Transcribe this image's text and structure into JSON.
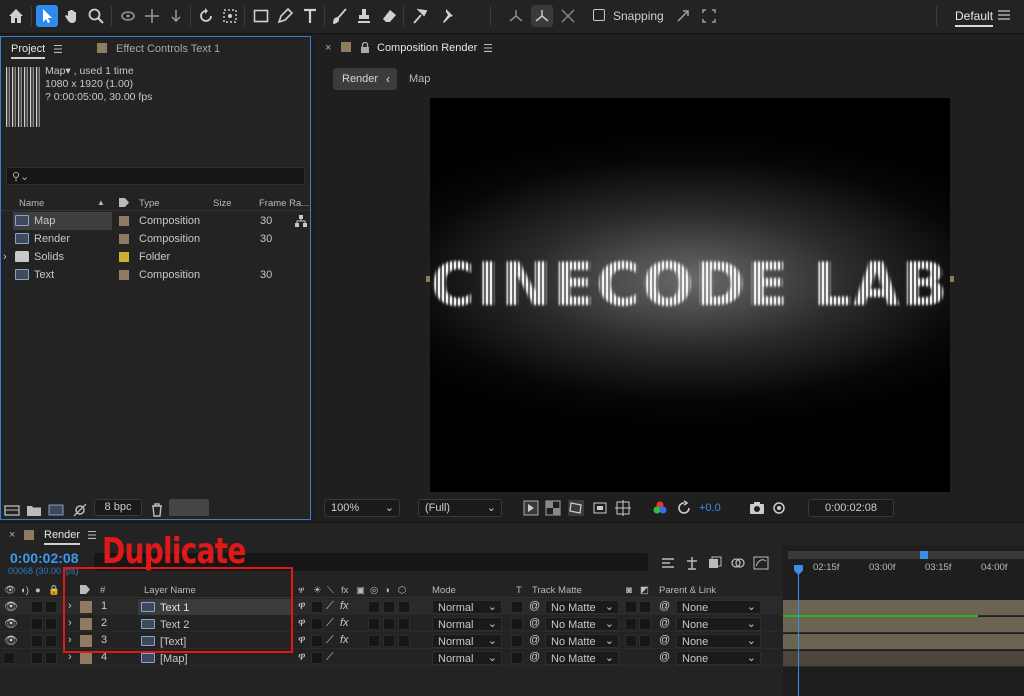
{
  "toolbar": {
    "snapping_label": "Snapping",
    "workspace": "Default"
  },
  "project_panel": {
    "tab_project": "Project",
    "tab_effect_controls": "Effect Controls Text 1",
    "selected_info": {
      "line1": "Map▾ , used 1 time",
      "line2": "1080 x 1920 (1.00)",
      "line3": "? 0:00:05:00, 30.00 fps"
    },
    "search_placeholder": "",
    "columns": [
      "Name",
      "Type",
      "Size",
      "Frame Ra..."
    ],
    "items": [
      {
        "name": "Map",
        "type": "Composition",
        "fps": "30",
        "color": "#8e7b62"
      },
      {
        "name": "Render",
        "type": "Composition",
        "fps": "30",
        "color": "#8e7b62"
      },
      {
        "name": "Solids",
        "type": "Folder",
        "fps": "",
        "color": "#c9b033"
      },
      {
        "name": "Text",
        "type": "Composition",
        "fps": "30",
        "color": "#8e7b62"
      }
    ],
    "bpc": "8 bpc"
  },
  "composition_panel": {
    "tab_title": "Composition Render",
    "breadcrumb": [
      "Render",
      "Map"
    ],
    "viewer_text": "CINECODE LAB",
    "zoom": "100%",
    "resolution": "(Full)",
    "exposure": "+0.0",
    "timecode": "0:00:02:08"
  },
  "timeline": {
    "tab_title": "Render",
    "timecode": "0:00:02:08",
    "frame_info": "00068 (30.00 fps)",
    "annotation": "Duplicate",
    "columns": [
      "#",
      "Layer Name",
      "Mode",
      "T",
      "Track Matte",
      "Parent & Link"
    ],
    "layers": [
      {
        "num": "1",
        "name": "Text 1",
        "mode": "Normal",
        "matte": "No Matte",
        "parent": "None"
      },
      {
        "num": "2",
        "name": "Text 2",
        "mode": "Normal",
        "matte": "No Matte",
        "parent": "None"
      },
      {
        "num": "3",
        "name": "[Text]",
        "mode": "Normal",
        "matte": "No Matte",
        "parent": "None"
      },
      {
        "num": "4",
        "name": "[Map]",
        "mode": "Normal",
        "matte": "No Matte",
        "parent": "None"
      }
    ],
    "ruler_ticks": [
      "02:15f",
      "03:00f",
      "03:15f",
      "04:00f"
    ]
  },
  "colors": {
    "accent": "#2d8ceb",
    "annotation": "#e01818",
    "label_sandstone": "#8e7b62",
    "label_yellow": "#c9b033"
  }
}
